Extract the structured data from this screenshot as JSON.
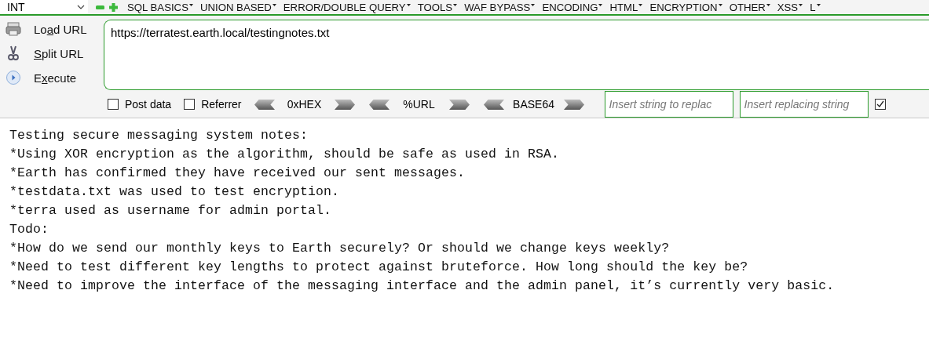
{
  "toolbar": {
    "type_select": {
      "value": "INT"
    },
    "menus": [
      {
        "label": "SQL BASICS"
      },
      {
        "label": "UNION BASED"
      },
      {
        "label": "ERROR/DOUBLE QUERY"
      },
      {
        "label": "TOOLS"
      },
      {
        "label": "WAF BYPASS"
      },
      {
        "label": "ENCODING"
      },
      {
        "label": "HTML"
      },
      {
        "label": "ENCRYPTION"
      },
      {
        "label": "OTHER"
      },
      {
        "label": "XSS"
      },
      {
        "label": "L"
      }
    ]
  },
  "actions": [
    {
      "kind": "load",
      "label_parts": [
        "Lo",
        "a",
        "d URL"
      ]
    },
    {
      "kind": "split",
      "label_parts": [
        "S",
        "plit URL"
      ]
    },
    {
      "kind": "execute",
      "label_parts": [
        "E",
        "x",
        "ecute"
      ]
    }
  ],
  "url_field": {
    "value": "https://terratest.earth.local/testingnotes.txt"
  },
  "options": {
    "post_data": {
      "label": "Post data",
      "checked": false
    },
    "referrer": {
      "label": "Referrer",
      "checked": false
    },
    "encoders": [
      {
        "label": "0xHEX"
      },
      {
        "label": "%URL"
      },
      {
        "label": "BASE64"
      }
    ],
    "replace_from": {
      "placeholder": "Insert string to replac"
    },
    "replace_to": {
      "placeholder": "Insert replacing string"
    },
    "replace_enabled": {
      "checked": true
    }
  },
  "content": {
    "lines": [
      "Testing secure messaging system notes:",
      "*Using XOR encryption as the algorithm, should be safe as used in RSA.",
      "*Earth has confirmed they have received our sent messages.",
      "*testdata.txt was used to test encryption.",
      "*terra used as username for admin portal.",
      "Todo:",
      "*How do we send our monthly keys to Earth securely? Or should we change keys weekly?",
      "*Need to test different key lengths to protect against bruteforce. How long should the key be?",
      "*Need to improve the interface of the messaging interface and the admin panel, it’s currently very basic."
    ]
  }
}
